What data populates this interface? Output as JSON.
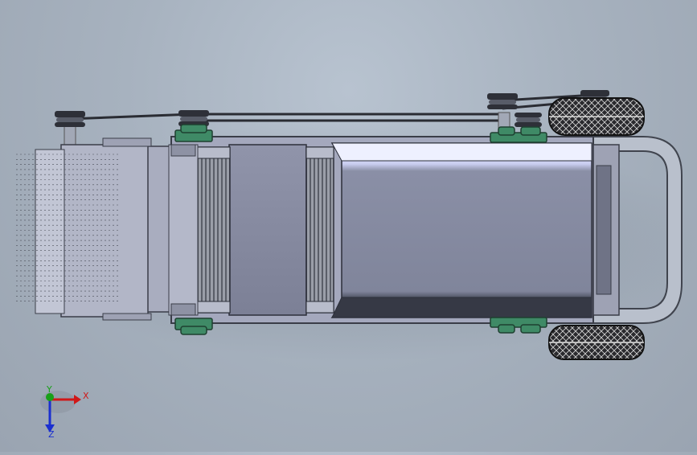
{
  "axes": {
    "x_label": "X",
    "y_label": "Y",
    "z_label": "Z",
    "x_color": "#d01818",
    "y_color": "#18a018",
    "z_color": "#1a2fd0"
  }
}
